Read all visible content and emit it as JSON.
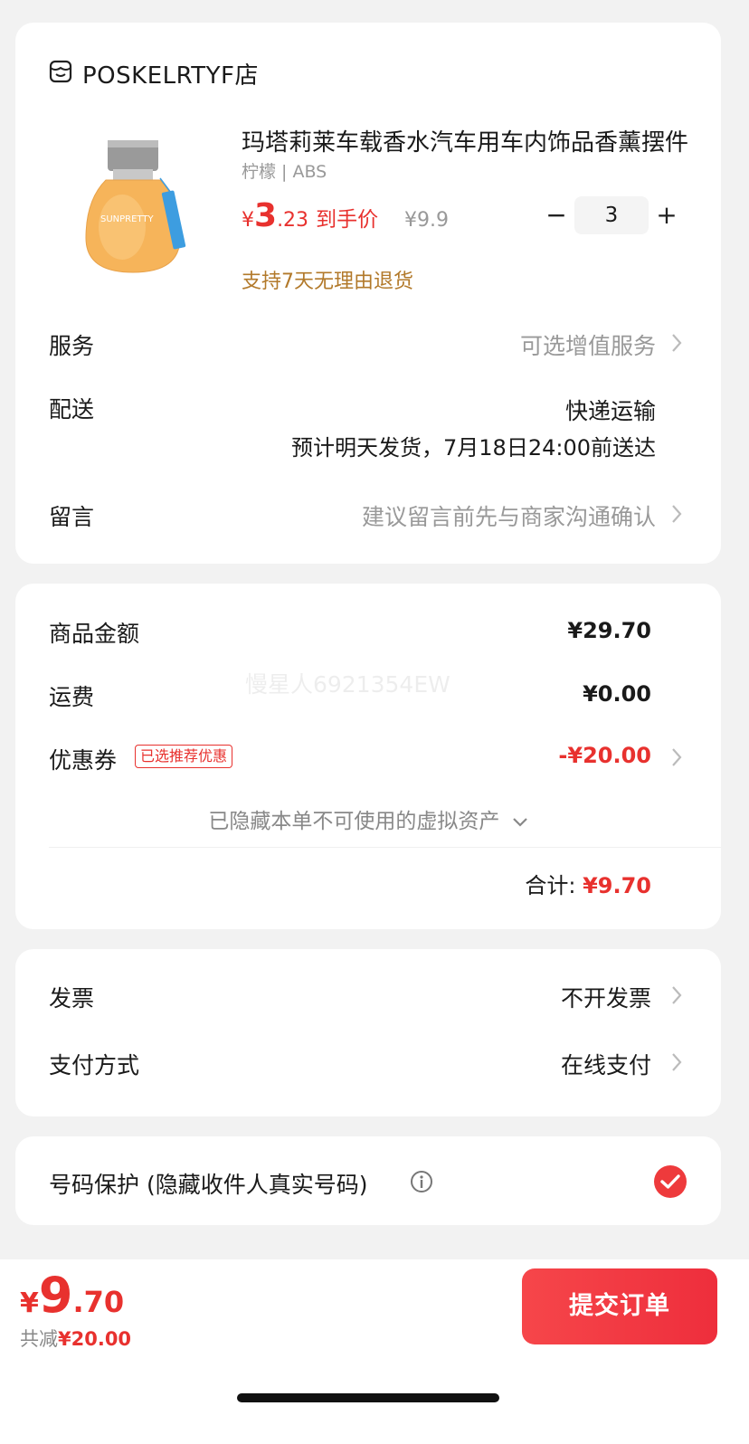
{
  "store": {
    "name": "POSKELRTYF店",
    "icon": "store-icon"
  },
  "product": {
    "title": "玛塔莉莱车载香水汽车用车内饰品香薰摆件",
    "spec": "柠檬 | ABS",
    "price_yen": "¥",
    "price_int": "3",
    "price_dec": ".23",
    "price_tag": "到手价",
    "original_price": "¥9.9",
    "qty_minus": "−",
    "quantity": "3",
    "qty_plus": "+",
    "return_policy": "支持7天无理由退货",
    "image_brand": "SUNPRETTY"
  },
  "service": {
    "label": "服务",
    "value": "可选增值服务"
  },
  "delivery": {
    "label": "配送",
    "method": "快递运输",
    "eta": "预计明天发货，7月18日24:00前送达"
  },
  "message": {
    "label": "留言",
    "placeholder": "建议留言前先与商家沟通确认"
  },
  "amounts": {
    "goods_label": "商品金额",
    "goods_value": "¥29.70",
    "shipping_label": "运费",
    "shipping_value": "¥0.00",
    "coupon_label": "优惠券",
    "coupon_badge": "已选推荐优惠",
    "coupon_value": "-¥20.00",
    "hidden_assets": "已隐藏本单不可使用的虚拟资产",
    "total_label": "合计: ",
    "total_value": "¥9.70",
    "watermark": "慢星人6921354EW"
  },
  "invoice": {
    "label": "发票",
    "value": "不开发票"
  },
  "payment": {
    "label": "支付方式",
    "value": "在线支付"
  },
  "privacy": {
    "label": "号码保护 (隐藏收件人真实号码)",
    "checked": true
  },
  "bottom": {
    "price_yen": "¥",
    "price_int": "9",
    "price_dec": ".70",
    "saved_label": "共减",
    "saved_value": "¥20.00",
    "submit_label": "提交订单"
  },
  "colors": {
    "accent": "#e8312e",
    "policy": "#b2792a",
    "muted": "#999999"
  }
}
